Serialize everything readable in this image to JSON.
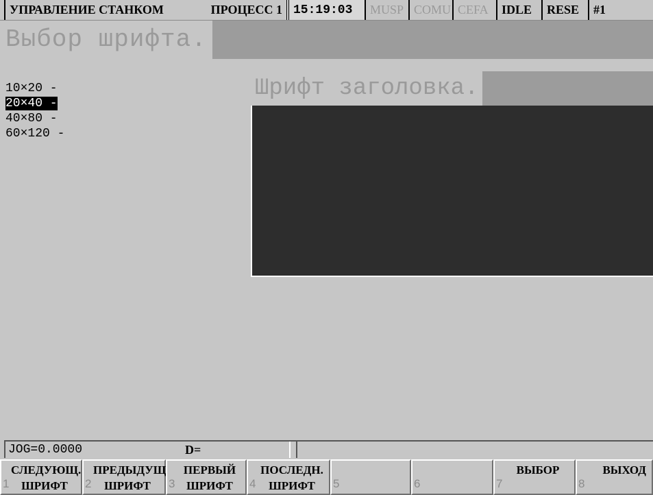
{
  "topbar": {
    "title": "УПРАВЛЕНИЕ СТАНКОМ",
    "process": "ПРОЦЕСС 1",
    "time": "15:19:03",
    "musp": "MUSP",
    "comu": "COMU",
    "cefa": "CEFA",
    "idle": "IDLE",
    "rese": "RESE",
    "channel": "#1"
  },
  "page_title": "Выбор шрифта.",
  "font_list": {
    "items": [
      "10×20 -",
      "20×40 -",
      "40×80 -",
      "60×120 -"
    ],
    "selected_index": 1
  },
  "preview": {
    "title": "Шрифт заголовка."
  },
  "status": {
    "jog": "JOG=0.0000",
    "d": "D="
  },
  "softkeys": [
    {
      "num": "1",
      "label": "СЛЕДУЮЩ.\nШРИФТ"
    },
    {
      "num": "2",
      "label": "ПРЕДЫДУЩ\nШРИФТ"
    },
    {
      "num": "3",
      "label": "ПЕРВЫЙ\nШРИФТ"
    },
    {
      "num": "4",
      "label": "ПОСЛЕДН.\nШРИФТ"
    },
    {
      "num": "5",
      "label": ""
    },
    {
      "num": "6",
      "label": ""
    },
    {
      "num": "7",
      "label": "ВЫБОР"
    },
    {
      "num": "8",
      "label": "ВЫХОД"
    }
  ],
  "colors": {
    "background": "#c6c6c6",
    "title_band": "#9c9c9c",
    "preview_canvas": "#2d2d2d",
    "dim_text": "#9a9a9a"
  }
}
